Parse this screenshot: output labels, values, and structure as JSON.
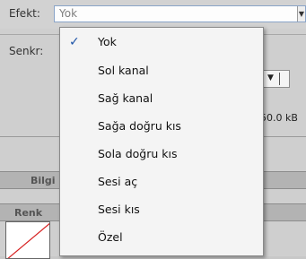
{
  "labels": {
    "effect": "Efekt:",
    "sync": "Senkr:"
  },
  "effect_combo": {
    "value": "Yok",
    "arrow_icon": "chevron-down-icon"
  },
  "background": {
    "size_text": "50.0 kB",
    "tabs": {
      "info": "Bilgi",
      "color": "Renk"
    }
  },
  "menu": {
    "selected_index": 0,
    "items": [
      "Yok",
      "Sol kanal",
      "Sağ kanal",
      "Sağa doğru kıs",
      "Sola doğru kıs",
      "Sesi aç",
      "Sesi kıs",
      "Özel"
    ]
  },
  "colors": {
    "accent": "#1e55a8",
    "panel": "#cfcfcf",
    "menu_bg": "#f4f4f4"
  }
}
